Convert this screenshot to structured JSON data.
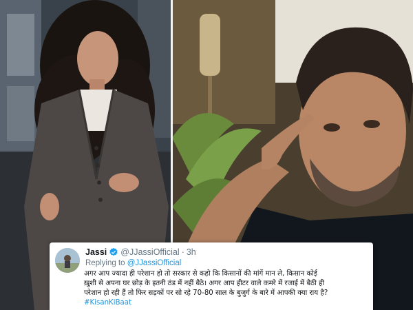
{
  "images": {
    "left_photo_icon": "woman-portrait-photo",
    "right_photo_icon": "man-selfie-photo"
  },
  "tweet": {
    "author_name": "Jassi",
    "handle": "@JJassiOfficial",
    "separator": "·",
    "time_ago": "3h",
    "replying_prefix": "Replying to",
    "replying_to": "@JJassiOfficial",
    "text_line_1": "अगर आप ज्यादा ही परेशान हो तो सरकार से कहो कि किसानों की मांगें मान ले, किसान कोई",
    "text_line_2": "ख़ुशी से अपना घर छोड़ के इतनी ठंड में नहीं बैठे। अगर आप हीटर वाले कमरे में रजाई में बैठी ही",
    "text_line_3": "परेशान हो रही हैं तो फिर सड़कों पर सो रहे 70-80 साल के बुजुर्ग के बारे में आपकी क्या राय है?",
    "hashtag": "#KisanKiBaat",
    "colors": {
      "link": "#1b95e0",
      "muted": "#657786",
      "verified": "#1da1f2"
    }
  }
}
